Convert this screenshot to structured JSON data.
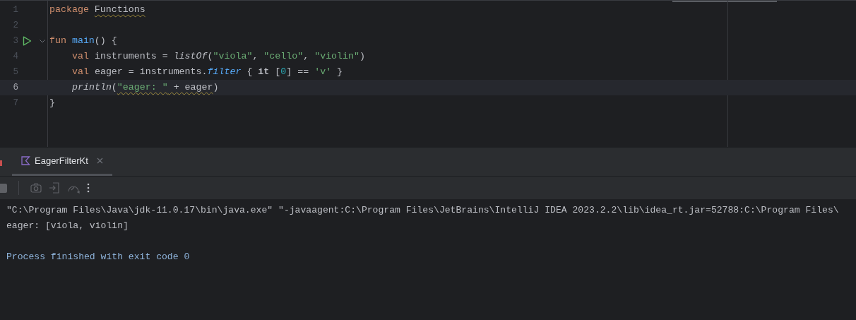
{
  "editor": {
    "lines": [
      {
        "number": "1",
        "run": false,
        "foldable": false,
        "current": false,
        "tokens": [
          {
            "text": "package ",
            "kind": "keyword",
            "warning": false
          },
          {
            "text": "Functions",
            "kind": "plain",
            "warning": true
          }
        ]
      },
      {
        "number": "2",
        "run": false,
        "foldable": false,
        "current": false
      },
      {
        "number": "3",
        "run": true,
        "foldable": true,
        "current": false,
        "tokens": [
          {
            "text": "fun ",
            "kind": "keyword",
            "warning": false
          },
          {
            "text": "main",
            "kind": "declaration",
            "warning": false
          },
          {
            "text": "() {",
            "kind": "plain",
            "warning": false
          }
        ],
        "children": [
          {
            "number": "4",
            "run": false,
            "foldable": false,
            "current": false,
            "tokens": [
              {
                "text": "val ",
                "kind": "keyword",
                "warning": false
              },
              {
                "text": "instruments = ",
                "kind": "plain",
                "warning": false
              },
              {
                "text": "listOf",
                "kind": "stdlib",
                "warning": false
              },
              {
                "text": "(",
                "kind": "plain",
                "warning": false
              },
              {
                "text": "\"viola\"",
                "kind": "string",
                "warning": false
              },
              {
                "text": ", ",
                "kind": "plain",
                "warning": false
              },
              {
                "text": "\"cello\"",
                "kind": "string",
                "warning": false
              },
              {
                "text": ", ",
                "kind": "plain",
                "warning": false
              },
              {
                "text": "\"violin\"",
                "kind": "string",
                "warning": false
              },
              {
                "text": ")",
                "kind": "plain",
                "warning": false
              }
            ]
          },
          {
            "number": "5",
            "run": false,
            "foldable": false,
            "current": false,
            "tokens": [
              {
                "text": "val ",
                "kind": "keyword",
                "warning": false
              },
              {
                "text": "eager = instruments.",
                "kind": "plain",
                "warning": false
              },
              {
                "text": "filter",
                "kind": "extension",
                "warning": false
              },
              {
                "text": " { ",
                "kind": "plain",
                "warning": false
              },
              {
                "text": "it",
                "kind": "implicit",
                "warning": false
              },
              {
                "text": " [",
                "kind": "plain",
                "warning": false
              },
              {
                "text": "0",
                "kind": "number",
                "warning": false
              },
              {
                "text": "] == ",
                "kind": "plain",
                "warning": false
              },
              {
                "text": "'v'",
                "kind": "string",
                "warning": false
              },
              {
                "text": " }",
                "kind": "plain",
                "warning": false
              }
            ]
          },
          {
            "number": "6",
            "run": false,
            "foldable": false,
            "current": true,
            "tokens": [
              {
                "text": "println",
                "kind": "stdlib",
                "warning": false
              },
              {
                "text": "(",
                "kind": "plain",
                "warning": false
              },
              {
                "text": "\"eager: \"",
                "kind": "string",
                "warning": true
              },
              {
                "text": " + eager",
                "kind": "plain",
                "warning": true
              },
              {
                "text": ")",
                "kind": "plain",
                "warning": false
              }
            ]
          }
        ]
      },
      {
        "number": "7",
        "run": false,
        "foldable": false,
        "current": false,
        "tokens": [
          {
            "text": "}",
            "kind": "plain",
            "warning": false
          }
        ]
      }
    ]
  },
  "run_panel": {
    "tabs": [
      {
        "label": "EagerFilterKt",
        "selected": true
      }
    ],
    "console": [
      {
        "text": "\"C:\\Program Files\\Java\\jdk-11.0.17\\bin\\java.exe\" \"-javaagent:C:\\Program Files\\JetBrains\\IntelliJ IDEA 2023.2.2\\lib\\idea_rt.jar=52788:C:\\Program Files\\",
        "kind": "command"
      },
      {
        "text": "eager: [viola, violin]",
        "kind": "output"
      },
      {
        "kind": "blank"
      },
      {
        "text": "Process finished with exit code 0",
        "kind": "system"
      }
    ]
  }
}
